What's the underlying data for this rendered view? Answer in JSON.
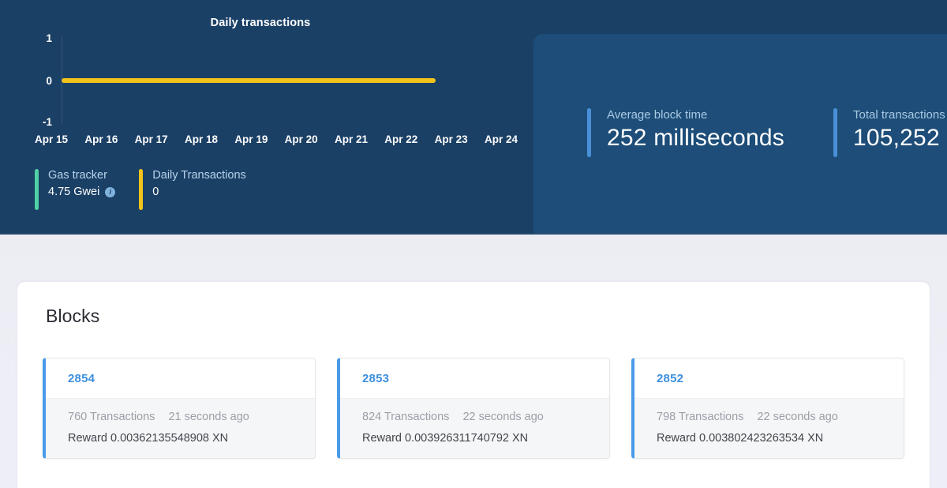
{
  "hero": {
    "chart_data": {
      "type": "line",
      "title": "Daily transactions",
      "xlabel": "",
      "ylabel": "",
      "categories": [
        "Apr 15",
        "Apr 16",
        "Apr 17",
        "Apr 18",
        "Apr 19",
        "Apr 20",
        "Apr 21",
        "Apr 22",
        "Apr 23",
        "Apr 24"
      ],
      "values": [
        0,
        0,
        0,
        0,
        0,
        0,
        0,
        0,
        0,
        null
      ],
      "series": [
        {
          "name": "Daily transactions",
          "values": [
            0,
            0,
            0,
            0,
            0,
            0,
            0,
            0,
            0,
            null
          ],
          "color": "#f2c31a"
        }
      ],
      "y_ticks": [
        "1",
        "0",
        "-1"
      ],
      "ylim": [
        -1,
        1
      ],
      "grid": false,
      "legend": "none",
      "line_color": "#f2c31a"
    },
    "gas_tracker": {
      "label": "Gas tracker",
      "value": "4.75 Gwei",
      "info_icon": "info-circle-icon",
      "accent_color": "#4fd1a5"
    },
    "daily_transactions": {
      "label": "Daily Transactions",
      "value": "0",
      "accent_color": "#f2c31a"
    },
    "stats": [
      {
        "label": "Average block time",
        "value": "252 milliseconds",
        "accent_color": "#4a90d9"
      },
      {
        "label": "Total transactions",
        "value": "105,252",
        "accent_color": "#4a90d9"
      }
    ]
  },
  "blocks_section": {
    "title": "Blocks",
    "cards": [
      {
        "number": "2854",
        "transactions": "760 Transactions",
        "age": "21 seconds ago",
        "reward": "Reward 0.00362135548908 XN"
      },
      {
        "number": "2853",
        "transactions": "824 Transactions",
        "age": "22 seconds ago",
        "reward": "Reward 0.003926311740792 XN"
      },
      {
        "number": "2852",
        "transactions": "798 Transactions",
        "age": "22 seconds ago",
        "reward": "Reward 0.003802423263534 XN"
      }
    ]
  },
  "colors": {
    "hero_background": "#1b4066",
    "hero_panel": "#1d4d78",
    "chart_line": "#f2c31a",
    "stat_accent": "#4a90d9",
    "gas_accent": "#4fd1a5",
    "block_accent": "#4a9ae8",
    "block_link": "#3d8fdd"
  }
}
